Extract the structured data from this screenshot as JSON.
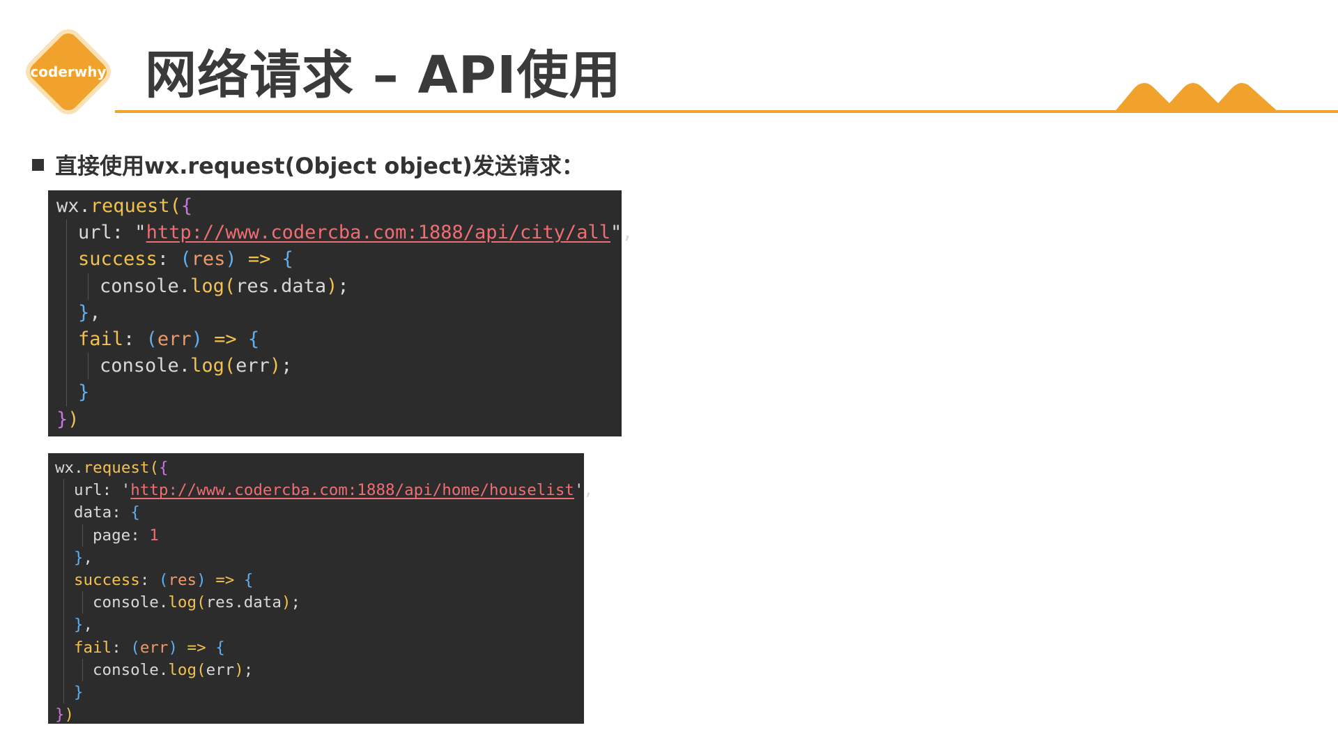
{
  "logo": {
    "text": "coderwhy"
  },
  "header": {
    "title": "网络请求 – API使用"
  },
  "colors": {
    "accent": "#f0a22c",
    "code_bg": "#2c2c2c"
  },
  "bullet": {
    "text": "直接使用wx.request(Object object)发送请求："
  },
  "code1": {
    "lines": [
      {
        "indent": 0,
        "tokens": [
          {
            "t": "wx",
            "c": "plain"
          },
          {
            "t": ".",
            "c": "plain"
          },
          {
            "t": "request",
            "c": "fn"
          },
          {
            "t": "(",
            "c": "paren"
          },
          {
            "t": "{",
            "c": "brace1"
          }
        ]
      },
      {
        "indent": 1,
        "tokens": [
          {
            "t": "url",
            "c": "plain"
          },
          {
            "t": ": \"",
            "c": "plain"
          },
          {
            "t": "http://www.codercba.com:1888/api/city/all",
            "c": "url"
          },
          {
            "t": "\",",
            "c": "plain"
          }
        ]
      },
      {
        "indent": 1,
        "tokens": [
          {
            "t": "success",
            "c": "key"
          },
          {
            "t": ": ",
            "c": "plain"
          },
          {
            "t": "(",
            "c": "brace2"
          },
          {
            "t": "res",
            "c": "param"
          },
          {
            "t": ")",
            "c": "brace2"
          },
          {
            "t": " => ",
            "c": "arrow"
          },
          {
            "t": "{",
            "c": "brace2"
          }
        ]
      },
      {
        "indent": 2,
        "tokens": [
          {
            "t": "console",
            "c": "plain"
          },
          {
            "t": ".",
            "c": "plain"
          },
          {
            "t": "log",
            "c": "fn"
          },
          {
            "t": "(",
            "c": "paren"
          },
          {
            "t": "res.data",
            "c": "plain"
          },
          {
            "t": ")",
            "c": "paren"
          },
          {
            "t": ";",
            "c": "plain"
          }
        ]
      },
      {
        "indent": 1,
        "tokens": [
          {
            "t": "}",
            "c": "brace2"
          },
          {
            "t": ",",
            "c": "plain"
          }
        ]
      },
      {
        "indent": 1,
        "tokens": [
          {
            "t": "fail",
            "c": "key"
          },
          {
            "t": ": ",
            "c": "plain"
          },
          {
            "t": "(",
            "c": "brace2"
          },
          {
            "t": "err",
            "c": "param"
          },
          {
            "t": ")",
            "c": "brace2"
          },
          {
            "t": " => ",
            "c": "arrow"
          },
          {
            "t": "{",
            "c": "brace2"
          }
        ]
      },
      {
        "indent": 2,
        "tokens": [
          {
            "t": "console",
            "c": "plain"
          },
          {
            "t": ".",
            "c": "plain"
          },
          {
            "t": "log",
            "c": "fn"
          },
          {
            "t": "(",
            "c": "paren"
          },
          {
            "t": "err",
            "c": "plain"
          },
          {
            "t": ")",
            "c": "paren"
          },
          {
            "t": ";",
            "c": "plain"
          }
        ]
      },
      {
        "indent": 1,
        "tokens": [
          {
            "t": "}",
            "c": "brace2"
          }
        ]
      },
      {
        "indent": 0,
        "tokens": [
          {
            "t": "}",
            "c": "brace1"
          },
          {
            "t": ")",
            "c": "paren"
          }
        ]
      }
    ]
  },
  "code2": {
    "lines": [
      {
        "indent": 0,
        "tokens": [
          {
            "t": "wx",
            "c": "plain"
          },
          {
            "t": ".",
            "c": "plain"
          },
          {
            "t": "request",
            "c": "fn"
          },
          {
            "t": "(",
            "c": "paren"
          },
          {
            "t": "{",
            "c": "brace1"
          }
        ]
      },
      {
        "indent": 1,
        "tokens": [
          {
            "t": "url",
            "c": "plain"
          },
          {
            "t": ": '",
            "c": "plain"
          },
          {
            "t": "http://www.codercba.com:1888/api/home/houselist",
            "c": "url"
          },
          {
            "t": "',",
            "c": "plain"
          }
        ]
      },
      {
        "indent": 1,
        "tokens": [
          {
            "t": "data",
            "c": "plain"
          },
          {
            "t": ": ",
            "c": "plain"
          },
          {
            "t": "{",
            "c": "brace2"
          }
        ]
      },
      {
        "indent": 2,
        "tokens": [
          {
            "t": "page",
            "c": "plain"
          },
          {
            "t": ": ",
            "c": "plain"
          },
          {
            "t": "1",
            "c": "num"
          }
        ]
      },
      {
        "indent": 1,
        "tokens": [
          {
            "t": "}",
            "c": "brace2"
          },
          {
            "t": ",",
            "c": "plain"
          }
        ]
      },
      {
        "indent": 1,
        "tokens": [
          {
            "t": "success",
            "c": "key"
          },
          {
            "t": ": ",
            "c": "plain"
          },
          {
            "t": "(",
            "c": "brace2"
          },
          {
            "t": "res",
            "c": "param"
          },
          {
            "t": ")",
            "c": "brace2"
          },
          {
            "t": " => ",
            "c": "arrow"
          },
          {
            "t": "{",
            "c": "brace2"
          }
        ]
      },
      {
        "indent": 2,
        "tokens": [
          {
            "t": "console",
            "c": "plain"
          },
          {
            "t": ".",
            "c": "plain"
          },
          {
            "t": "log",
            "c": "fn"
          },
          {
            "t": "(",
            "c": "paren"
          },
          {
            "t": "res.data",
            "c": "plain"
          },
          {
            "t": ")",
            "c": "paren"
          },
          {
            "t": ";",
            "c": "plain"
          }
        ]
      },
      {
        "indent": 1,
        "tokens": [
          {
            "t": "}",
            "c": "brace2"
          },
          {
            "t": ",",
            "c": "plain"
          }
        ]
      },
      {
        "indent": 1,
        "tokens": [
          {
            "t": "fail",
            "c": "key"
          },
          {
            "t": ": ",
            "c": "plain"
          },
          {
            "t": "(",
            "c": "brace2"
          },
          {
            "t": "err",
            "c": "param"
          },
          {
            "t": ")",
            "c": "brace2"
          },
          {
            "t": " => ",
            "c": "arrow"
          },
          {
            "t": "{",
            "c": "brace2"
          }
        ]
      },
      {
        "indent": 2,
        "tokens": [
          {
            "t": "console",
            "c": "plain"
          },
          {
            "t": ".",
            "c": "plain"
          },
          {
            "t": "log",
            "c": "fn"
          },
          {
            "t": "(",
            "c": "paren"
          },
          {
            "t": "err",
            "c": "plain"
          },
          {
            "t": ")",
            "c": "paren"
          },
          {
            "t": ";",
            "c": "plain"
          }
        ]
      },
      {
        "indent": 1,
        "tokens": [
          {
            "t": "}",
            "c": "brace2"
          }
        ]
      },
      {
        "indent": 0,
        "tokens": [
          {
            "t": "}",
            "c": "brace1"
          },
          {
            "t": ")",
            "c": "paren"
          }
        ]
      }
    ]
  }
}
